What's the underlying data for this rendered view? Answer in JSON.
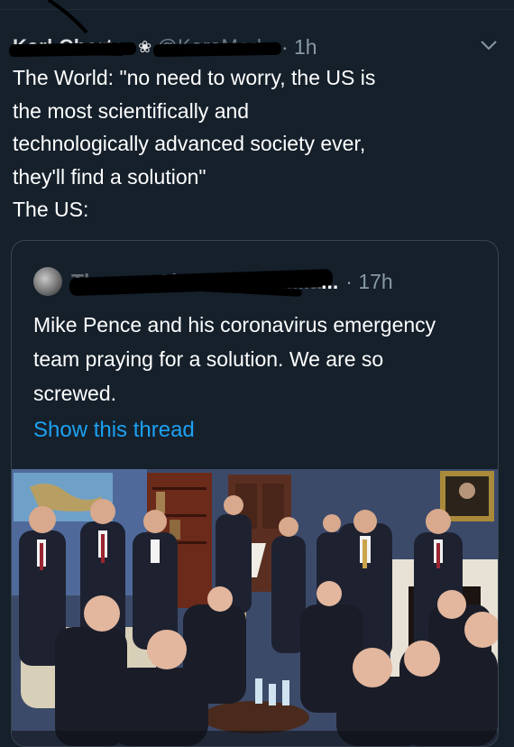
{
  "tweet": {
    "author_name": "Karl Charter",
    "handle": "@KareMarks",
    "time": "1h",
    "text": "The World: \"no need to worry, the US is\nthe most scientifically and\ntechnologically advanced society ever,\nthey'll find a solution\"\nThe US:"
  },
  "quote": {
    "author_name_hidden": "Thomas Chatterton Willia",
    "author_name_tail": "...",
    "time": "17h",
    "text": "Mike Pence and his coronavirus emergency team praying for a solution. We are so screwed.",
    "show_thread": "Show this thread"
  },
  "colors": {
    "background": "#15202b",
    "secondary_text": "#8899a6",
    "link": "#1da1f2",
    "border": "#38444d"
  },
  "icons": {
    "verified": "verified-badge-icon",
    "chevron": "chevron-down-icon"
  }
}
